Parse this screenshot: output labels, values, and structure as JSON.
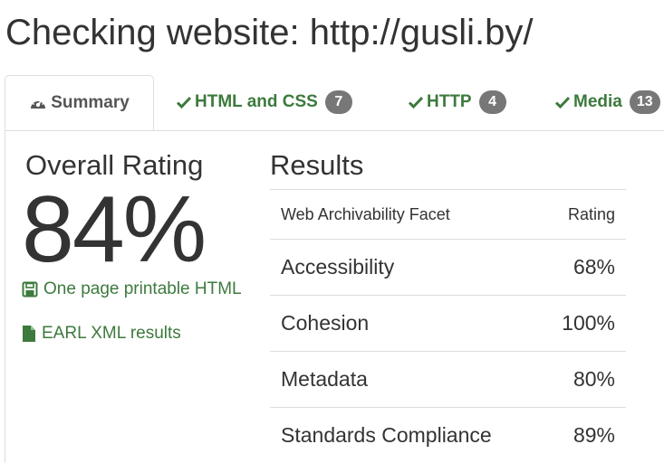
{
  "page": {
    "title": "Checking website: http://gusli.by/"
  },
  "tabs": [
    {
      "label": "Summary",
      "icon": "dashboard-icon",
      "active": true
    },
    {
      "label": "HTML and CSS",
      "icon": "check-icon",
      "badge": "7"
    },
    {
      "label": "HTTP",
      "icon": "check-icon",
      "badge": "4"
    },
    {
      "label": "Media",
      "icon": "check-icon",
      "badge": "13"
    }
  ],
  "summary": {
    "overall_heading": "Overall Rating",
    "overall_value": "84%",
    "links": [
      {
        "label": "One page printable HTML",
        "icon": "save-icon"
      },
      {
        "label": "EARL XML results",
        "icon": "file-icon"
      }
    ]
  },
  "results": {
    "heading": "Results",
    "columns": [
      "Web Archivability Facet",
      "Rating"
    ],
    "rows": [
      {
        "facet": "Accessibility",
        "rating": "68%"
      },
      {
        "facet": "Cohesion",
        "rating": "100%"
      },
      {
        "facet": "Metadata",
        "rating": "80%"
      },
      {
        "facet": "Standards Compliance",
        "rating": "89%"
      }
    ]
  },
  "colors": {
    "accent_green": "#3d7a3d",
    "badge_gray": "#777777",
    "text": "#333333",
    "border": "#dddddd"
  }
}
